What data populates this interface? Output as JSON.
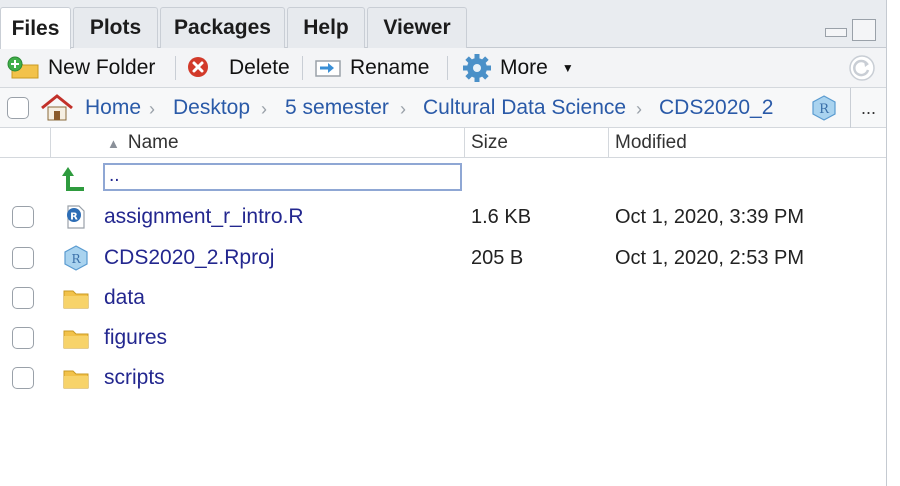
{
  "tabs": [
    {
      "label": "Files",
      "active": true
    },
    {
      "label": "Plots",
      "active": false
    },
    {
      "label": "Packages",
      "active": false
    },
    {
      "label": "Help",
      "active": false
    },
    {
      "label": "Viewer",
      "active": false
    }
  ],
  "toolbar": {
    "new_folder": "New Folder",
    "delete": "Delete",
    "rename": "Rename",
    "more": "More"
  },
  "breadcrumb": [
    "Home",
    "Desktop",
    "5 semester",
    "Cultural Data Science",
    "CDS2020_2"
  ],
  "breadcrumb_more": "...",
  "columns": {
    "name": "Name",
    "size": "Size",
    "modified": "Modified"
  },
  "up_entry": "..",
  "files": [
    {
      "name": "assignment_r_intro.R",
      "size": "1.6 KB",
      "modified": "Oct 1, 2020, 3:39 PM",
      "icon": "r-script-icon"
    },
    {
      "name": "CDS2020_2.Rproj",
      "size": "205 B",
      "modified": "Oct 1, 2020, 2:53 PM",
      "icon": "rproj-icon"
    },
    {
      "name": "data",
      "size": "",
      "modified": "",
      "icon": "folder-icon"
    },
    {
      "name": "figures",
      "size": "",
      "modified": "",
      "icon": "folder-icon"
    },
    {
      "name": "scripts",
      "size": "",
      "modified": "",
      "icon": "folder-icon"
    }
  ],
  "colors": {
    "link": "#23278f",
    "crumb": "#2a5aa8",
    "folder": "#f2c24a",
    "delete": "#d23a2a",
    "accent": "#3a8fd6"
  }
}
